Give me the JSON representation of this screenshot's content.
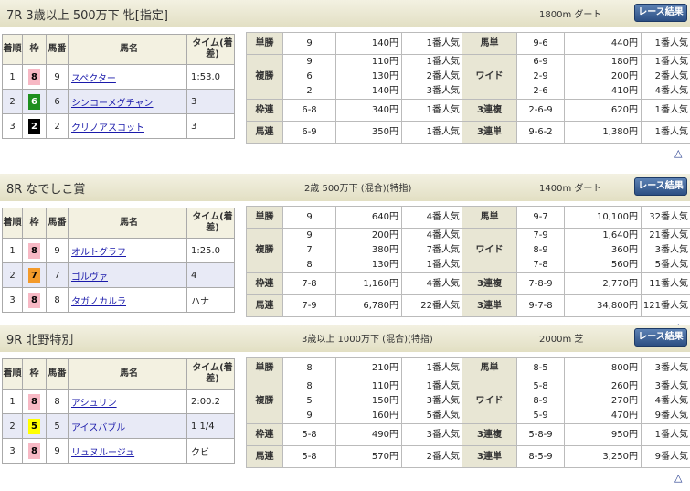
{
  "races": [
    {
      "title": "7R 3歳以上 500万下 牝[指定]",
      "conditions": "",
      "distance": "1800m  ダート",
      "button_label": "レース結果",
      "header": [
        "着順",
        "枠",
        "馬番",
        "馬名",
        "タイム(着差)"
      ],
      "results": [
        {
          "pos": "1",
          "waku": "8",
          "num": "9",
          "name": "スペクター",
          "time": "1:53.0"
        },
        {
          "pos": "2",
          "waku": "6",
          "num": "6",
          "name": "シンコーメグチャン",
          "time": "3"
        },
        {
          "pos": "3",
          "waku": "2",
          "num": "2",
          "name": "クリノアスコット",
          "time": "3"
        }
      ],
      "payouts": {
        "tansho": {
          "label": "単勝",
          "nums": [
            "9"
          ],
          "yen": [
            "140円"
          ],
          "pop": [
            "1番人気"
          ]
        },
        "fukusho": {
          "label": "複勝",
          "nums": [
            "9",
            "6",
            "2"
          ],
          "yen": [
            "110円",
            "130円",
            "140円"
          ],
          "pop": [
            "1番人気",
            "2番人気",
            "3番人気"
          ]
        },
        "wakuren": {
          "label": "枠連",
          "nums": [
            "6-8"
          ],
          "yen": [
            "340円"
          ],
          "pop": [
            "1番人気"
          ]
        },
        "umaren": {
          "label": "馬連",
          "nums": [
            "6-9"
          ],
          "yen": [
            "350円"
          ],
          "pop": [
            "1番人気"
          ]
        },
        "umatan": {
          "label": "馬単",
          "nums": [
            "9-6"
          ],
          "yen": [
            "440円"
          ],
          "pop": [
            "1番人気"
          ]
        },
        "wide": {
          "label": "ワイド",
          "nums": [
            "6-9",
            "2-9",
            "2-6"
          ],
          "yen": [
            "180円",
            "200円",
            "410円"
          ],
          "pop": [
            "1番人気",
            "2番人気",
            "4番人気"
          ]
        },
        "sanrenpuku": {
          "label": "3連複",
          "nums": [
            "2-6-9"
          ],
          "yen": [
            "620円"
          ],
          "pop": [
            "1番人気"
          ]
        },
        "sanrentan": {
          "label": "3連単",
          "nums": [
            "9-6-2"
          ],
          "yen": [
            "1,380円"
          ],
          "pop": [
            "1番人気"
          ]
        }
      }
    },
    {
      "title": "8R なでしこ賞",
      "conditions": "2歳 500万下 (混合)(特指)",
      "distance": "1400m  ダート",
      "button_label": "レース結果",
      "header": [
        "着順",
        "枠",
        "馬番",
        "馬名",
        "タイム(着差)"
      ],
      "results": [
        {
          "pos": "1",
          "waku": "8",
          "num": "9",
          "name": "オルトグラフ",
          "time": "1:25.0"
        },
        {
          "pos": "2",
          "waku": "7",
          "num": "7",
          "name": "ゴルヴァ",
          "time": "4"
        },
        {
          "pos": "3",
          "waku": "8",
          "num": "8",
          "name": "タガノカルラ",
          "time": "ハナ"
        }
      ],
      "payouts": {
        "tansho": {
          "label": "単勝",
          "nums": [
            "9"
          ],
          "yen": [
            "640円"
          ],
          "pop": [
            "4番人気"
          ]
        },
        "fukusho": {
          "label": "複勝",
          "nums": [
            "9",
            "7",
            "8"
          ],
          "yen": [
            "200円",
            "380円",
            "130円"
          ],
          "pop": [
            "4番人気",
            "7番人気",
            "1番人気"
          ]
        },
        "wakuren": {
          "label": "枠連",
          "nums": [
            "7-8"
          ],
          "yen": [
            "1,160円"
          ],
          "pop": [
            "4番人気"
          ]
        },
        "umaren": {
          "label": "馬連",
          "nums": [
            "7-9"
          ],
          "yen": [
            "6,780円"
          ],
          "pop": [
            "22番人気"
          ]
        },
        "umatan": {
          "label": "馬単",
          "nums": [
            "9-7"
          ],
          "yen": [
            "10,100円"
          ],
          "pop": [
            "32番人気"
          ]
        },
        "wide": {
          "label": "ワイド",
          "nums": [
            "7-9",
            "8-9",
            "7-8"
          ],
          "yen": [
            "1,640円",
            "360円",
            "560円"
          ],
          "pop": [
            "21番人気",
            "3番人気",
            "5番人気"
          ]
        },
        "sanrenpuku": {
          "label": "3連複",
          "nums": [
            "7-8-9"
          ],
          "yen": [
            "2,770円"
          ],
          "pop": [
            "11番人気"
          ]
        },
        "sanrentan": {
          "label": "3連単",
          "nums": [
            "9-7-8"
          ],
          "yen": [
            "34,800円"
          ],
          "pop": [
            "121番人気"
          ]
        }
      }
    },
    {
      "title": "9R 北野特別",
      "conditions": "3歳以上 1000万下 (混合)(特指)",
      "distance": "2000m  芝",
      "button_label": "レース結果",
      "header": [
        "着順",
        "枠",
        "馬番",
        "馬名",
        "タイム(着差)"
      ],
      "results": [
        {
          "pos": "1",
          "waku": "8",
          "num": "8",
          "name": "アシュリン",
          "time": "2:00.2"
        },
        {
          "pos": "2",
          "waku": "5",
          "num": "5",
          "name": "アイスバブル",
          "time": "1 1/4"
        },
        {
          "pos": "3",
          "waku": "8",
          "num": "9",
          "name": "リュヌルージュ",
          "time": "クビ"
        }
      ],
      "payouts": {
        "tansho": {
          "label": "単勝",
          "nums": [
            "8"
          ],
          "yen": [
            "210円"
          ],
          "pop": [
            "1番人気"
          ]
        },
        "fukusho": {
          "label": "複勝",
          "nums": [
            "8",
            "5",
            "9"
          ],
          "yen": [
            "110円",
            "150円",
            "160円"
          ],
          "pop": [
            "1番人気",
            "3番人気",
            "5番人気"
          ]
        },
        "wakuren": {
          "label": "枠連",
          "nums": [
            "5-8"
          ],
          "yen": [
            "490円"
          ],
          "pop": [
            "3番人気"
          ]
        },
        "umaren": {
          "label": "馬連",
          "nums": [
            "5-8"
          ],
          "yen": [
            "570円"
          ],
          "pop": [
            "2番人気"
          ]
        },
        "umatan": {
          "label": "馬単",
          "nums": [
            "8-5"
          ],
          "yen": [
            "800円"
          ],
          "pop": [
            "3番人気"
          ]
        },
        "wide": {
          "label": "ワイド",
          "nums": [
            "5-8",
            "8-9",
            "5-9"
          ],
          "yen": [
            "260円",
            "270円",
            "470円"
          ],
          "pop": [
            "3番人気",
            "4番人気",
            "9番人気"
          ]
        },
        "sanrenpuku": {
          "label": "3連複",
          "nums": [
            "5-8-9"
          ],
          "yen": [
            "950円"
          ],
          "pop": [
            "1番人気"
          ]
        },
        "sanrentan": {
          "label": "3連単",
          "nums": [
            "8-5-9"
          ],
          "yen": [
            "3,250円"
          ],
          "pop": [
            "9番人気"
          ]
        }
      }
    }
  ],
  "waku_colors": {
    "1": {
      "bg": "#ffffff",
      "fg": "#000000"
    },
    "2": {
      "bg": "#000000",
      "fg": "#ffffff"
    },
    "5": {
      "bg": "#ffff00",
      "fg": "#000000"
    },
    "6": {
      "bg": "#1e8f1e",
      "fg": "#ffffff"
    },
    "7": {
      "bg": "#f39a2a",
      "fg": "#000000"
    },
    "8": {
      "bg": "#f7b8c4",
      "fg": "#000000"
    }
  },
  "back_to_top_icon": "△"
}
